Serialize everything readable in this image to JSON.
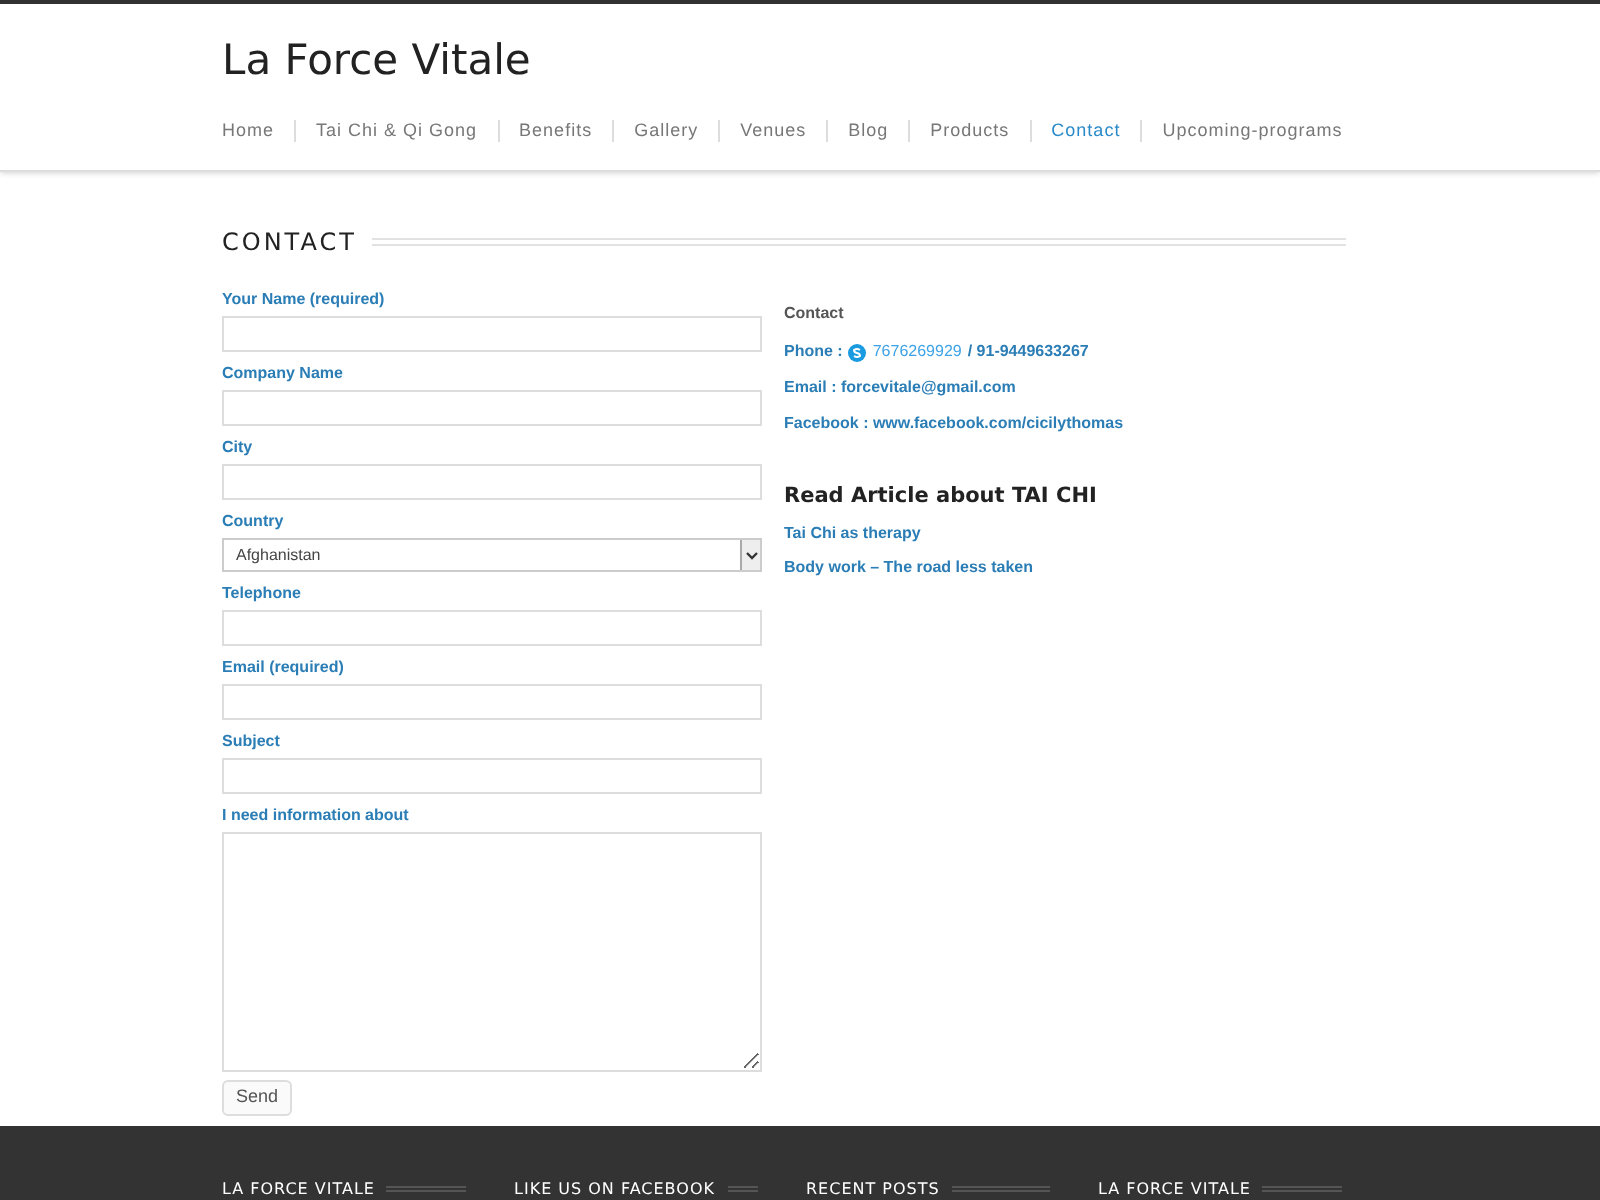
{
  "site_title": "La Force Vitale",
  "nav": [
    {
      "label": "Home",
      "selected": false
    },
    {
      "label": "Tai Chi & Qi Gong",
      "selected": false
    },
    {
      "label": "Benefits",
      "selected": false
    },
    {
      "label": "Gallery",
      "selected": false
    },
    {
      "label": "Venues",
      "selected": false
    },
    {
      "label": "Blog",
      "selected": false
    },
    {
      "label": "Products",
      "selected": false
    },
    {
      "label": "Contact",
      "selected": true
    },
    {
      "label": "Upcoming-programs",
      "selected": false
    }
  ],
  "page_title": "CONTACT",
  "form": {
    "fields": [
      {
        "kind": "text",
        "label": "Your Name (required)"
      },
      {
        "kind": "text",
        "label": "Company Name"
      },
      {
        "kind": "text",
        "label": "City"
      },
      {
        "kind": "select",
        "label": "Country",
        "value": "Afghanistan"
      },
      {
        "kind": "text",
        "label": "Telephone"
      },
      {
        "kind": "text",
        "label": "Email (required)"
      },
      {
        "kind": "text",
        "label": "Subject"
      },
      {
        "kind": "textarea",
        "label": "I need information about"
      }
    ],
    "submit": "Send"
  },
  "contact": {
    "heading": "Contact",
    "phone_label": "Phone :",
    "phone_skype": "7676269929",
    "phone_other": "/ 91-9449633267",
    "email": "Email : forcevitale@gmail.com",
    "facebook": "Facebook : www.facebook.com/cicilythomas"
  },
  "articles": {
    "heading": "Read Article about TAI CHI",
    "links": [
      "Tai Chi as therapy",
      "Body work – The road less taken"
    ]
  },
  "footer": {
    "headings": [
      "LA FORCE VITALE",
      "LIKE US ON FACEBOOK",
      "RECENT POSTS",
      "LA FORCE VITALE"
    ]
  }
}
